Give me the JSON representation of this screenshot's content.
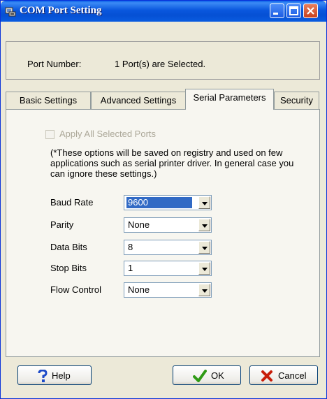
{
  "window": {
    "title": "COM Port Setting"
  },
  "port": {
    "label": "Port Number:",
    "value": "1 Port(s) are Selected."
  },
  "tabs": [
    {
      "label": "Basic Settings"
    },
    {
      "label": "Advanced Settings"
    },
    {
      "label": "Serial Parameters",
      "active": true
    },
    {
      "label": "Security"
    }
  ],
  "apply_all": {
    "label": "Apply All Selected Ports",
    "checked": false,
    "enabled": false
  },
  "note": "(*These options will be saved on registry and used on few applications such as serial printer driver. In general case you can ignore these settings.)",
  "fields": {
    "baud_rate": {
      "label": "Baud Rate",
      "value": "9600"
    },
    "parity": {
      "label": "Parity",
      "value": "None"
    },
    "data_bits": {
      "label": "Data Bits",
      "value": "8"
    },
    "stop_bits": {
      "label": "Stop Bits",
      "value": "1"
    },
    "flow_control": {
      "label": "Flow Control",
      "value": "None"
    }
  },
  "buttons": {
    "help": "Help",
    "ok": "OK",
    "cancel": "Cancel"
  },
  "colors": {
    "titlebar": "#0A57DE",
    "face": "#ECE9D8",
    "selection": "#316AC5",
    "close": "#C7411F"
  }
}
